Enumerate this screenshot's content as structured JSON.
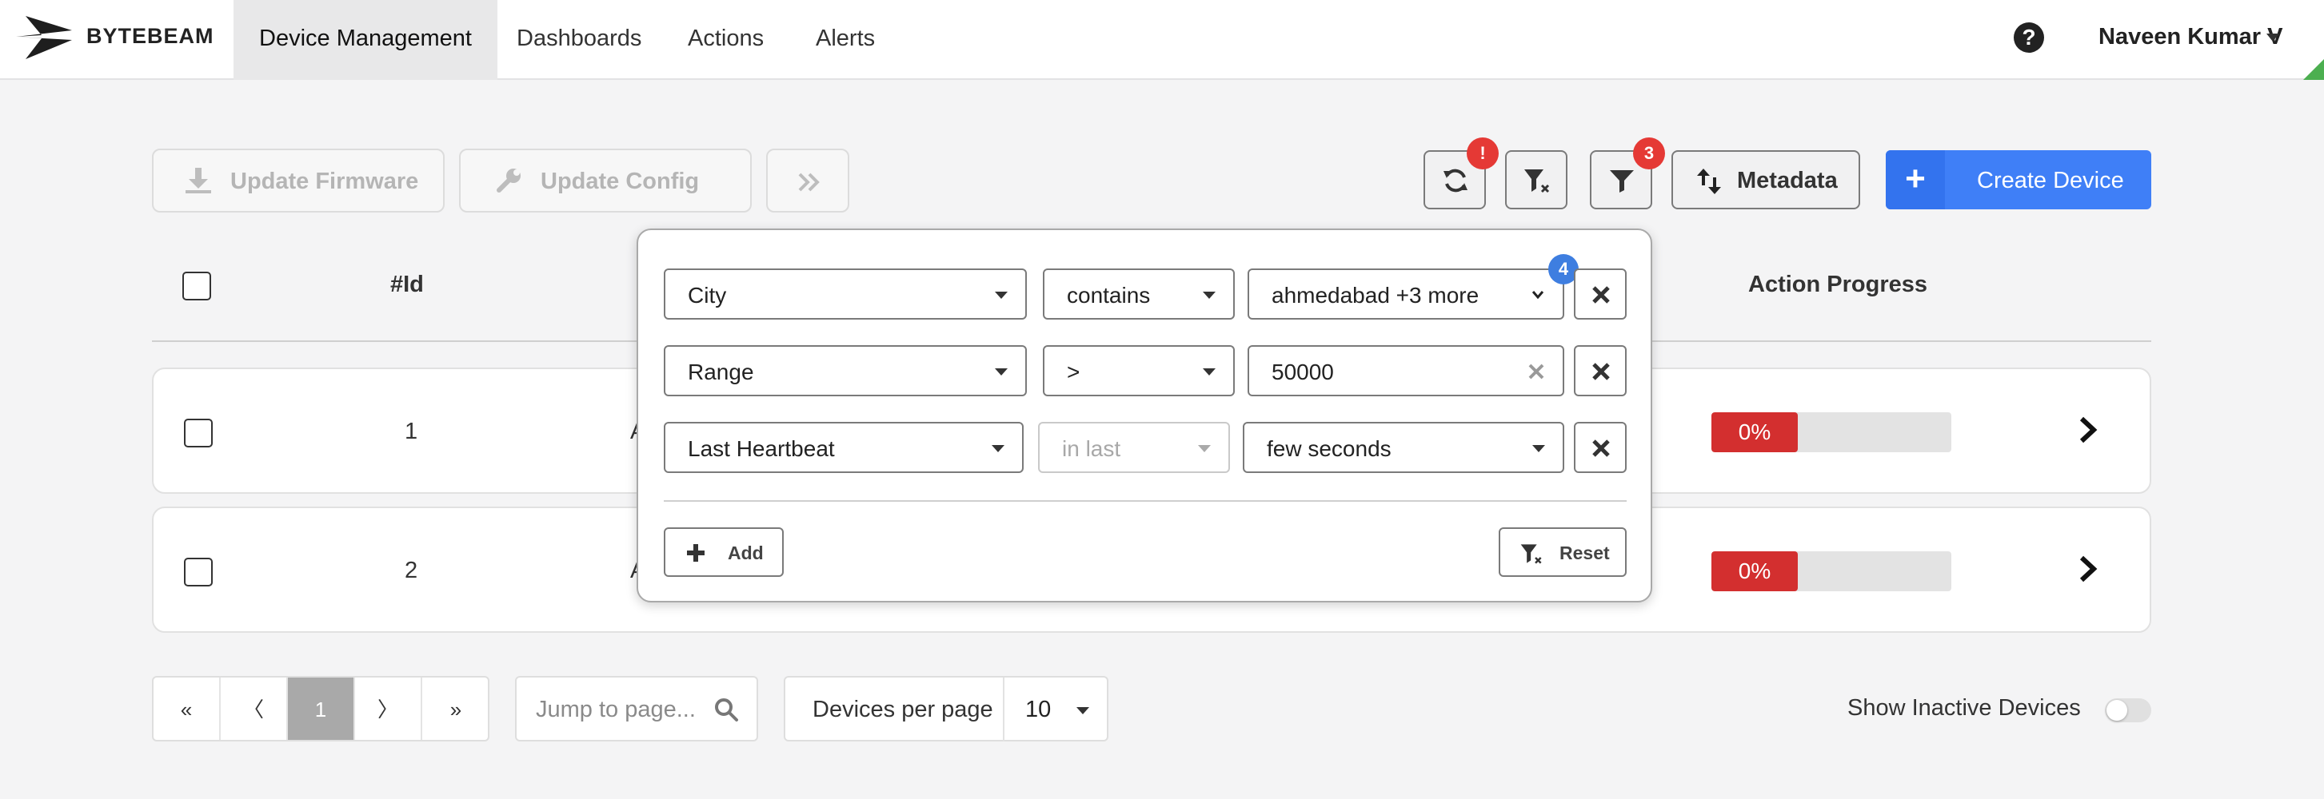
{
  "navbar": {
    "brand": "BYTEBEAM",
    "items": [
      "Device Management",
      "Dashboards",
      "Actions",
      "Alerts"
    ],
    "help_label": "?",
    "user_name": "Naveen Kumar V"
  },
  "toolbar": {
    "update_firmware": "Update Firmware",
    "update_config": "Update Config",
    "refresh_badge": "!",
    "filter_badge": "3",
    "metadata": "Metadata",
    "create_device": "Create Device",
    "create_plus": "+"
  },
  "table": {
    "columns": [
      "#Id",
      "Action Progress"
    ],
    "rows": [
      {
        "id": "1",
        "name_truncated": "A",
        "progress": "0%",
        "progress_value": 0
      },
      {
        "id": "2",
        "name_truncated": "A",
        "progress": "0%",
        "progress_value": 0
      }
    ]
  },
  "filter_popup": {
    "rows": [
      {
        "field": "City",
        "operator": "contains",
        "value": "ahmedabad +3 more",
        "value_badge": "4"
      },
      {
        "field": "Range",
        "operator": ">",
        "value": "50000"
      },
      {
        "field": "Last Heartbeat",
        "operator": "in last",
        "value": "few seconds"
      }
    ],
    "add_label": "Add",
    "reset_label": "Reset"
  },
  "pagination": {
    "first": "«",
    "prev": "〈",
    "current": "1",
    "next": "〉",
    "last": "»",
    "jump_placeholder": "Jump to page...",
    "per_page_label": "Devices per page",
    "per_page_value": "10"
  },
  "show_inactive_label": "Show Inactive Devices",
  "colors": {
    "primary": "#3f7ff7",
    "danger": "#d32f2f",
    "badge_red": "#e53935",
    "badge_blue": "#3e7ee0"
  }
}
